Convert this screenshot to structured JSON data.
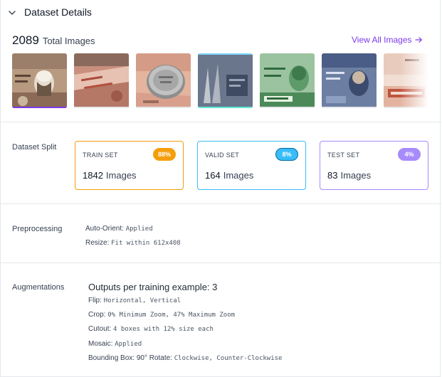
{
  "header": {
    "title": "Dataset Details"
  },
  "total": {
    "count": "2089",
    "label": "Total Images"
  },
  "view_all": {
    "label": "View All Images"
  },
  "thumbnails": [
    {
      "name": "banknote-portrait-brown",
      "bar_color": "#7c3aed"
    },
    {
      "name": "banknote-red-closeup",
      "bar_color": "#e5e7eb"
    },
    {
      "name": "coin-on-banknote",
      "bar_color": "#e5e7eb"
    },
    {
      "name": "banknote-blue-gray",
      "bar_color": "#e5e7eb"
    },
    {
      "name": "banknote-green-portrait",
      "bar_color": "#e5e7eb"
    },
    {
      "name": "banknote-blue-portrait",
      "bar_color": "#e5e7eb"
    },
    {
      "name": "banknote-red-text",
      "bar_color": "#e5e7eb"
    }
  ],
  "split": {
    "label": "Dataset Split",
    "train": {
      "name": "TRAIN SET",
      "percent": "88%",
      "count": "1842",
      "unit": "Images",
      "color": "#f59e0b"
    },
    "valid": {
      "name": "VALID SET",
      "percent": "8%",
      "count": "164",
      "unit": "Images",
      "color": "#38bdf8"
    },
    "test": {
      "name": "TEST SET",
      "percent": "4%",
      "count": "83",
      "unit": "Images",
      "color": "#a78bfa"
    }
  },
  "preprocessing": {
    "label": "Preprocessing",
    "items": [
      {
        "key": "Auto-Orient: ",
        "value": "Applied"
      },
      {
        "key": "Resize: ",
        "value": "Fit within 612x408"
      }
    ]
  },
  "augmentations": {
    "label": "Augmentations",
    "outputs": "Outputs per training example: 3",
    "items": [
      {
        "key": "Flip: ",
        "value": "Horizontal, Vertical"
      },
      {
        "key": "Crop: ",
        "value": "0% Minimum Zoom, 47% Maximum Zoom"
      },
      {
        "key": "Cutout: ",
        "value": "4 boxes with 12% size each"
      },
      {
        "key": "Mosaic: ",
        "value": "Applied"
      },
      {
        "key": "Bounding Box: 90° Rotate: ",
        "value": "Clockwise, Counter-Clockwise"
      }
    ]
  },
  "colors": {
    "accent": "#7c3aed",
    "divider": "#e5e7eb"
  }
}
